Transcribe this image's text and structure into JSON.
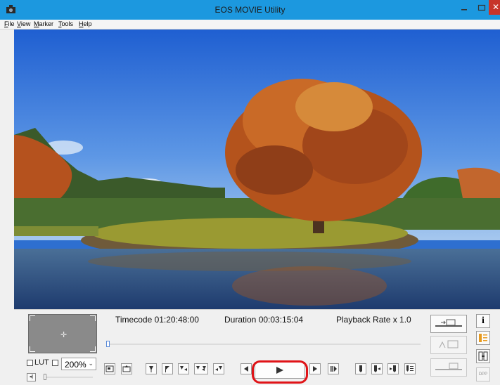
{
  "window": {
    "title": "EOS MOVIE Utility"
  },
  "menu": [
    "File",
    "View",
    "Marker",
    "Tools",
    "Help"
  ],
  "video": {
    "description_icon": "tree-landscape"
  },
  "info": {
    "timecode": "Timecode 01:20:48:00",
    "duration": "Duration 00:03:15:04",
    "playback_rate": "Playback Rate x 1.0"
  },
  "seek": {
    "position": 0.0
  },
  "options": {
    "lut_label": "LUT",
    "zoom_value": "200%"
  },
  "volume": {
    "level": 0.0
  },
  "controls": {
    "icons": [
      "save-frame-icon",
      "save-frame-as-icon",
      "mark-in-icon",
      "mark-out-icon",
      "go-to-in-icon",
      "go-to-in-out-icon",
      "go-to-out-icon",
      "prev-frame-icon",
      "play-icon",
      "next-frame-icon",
      "last-frame-icon",
      "marker-icon",
      "prev-marker-icon",
      "next-marker-icon",
      "marker-list-icon"
    ]
  },
  "side": {
    "icons": [
      "info-icon",
      "marker-panel-icon",
      "split-icon",
      "dpp-icon"
    ],
    "info_label": "i",
    "dpp_label": "DPP"
  },
  "colors": {
    "titlebar": "#1c98df",
    "highlight": "#e01418",
    "close": "#c7352a"
  }
}
